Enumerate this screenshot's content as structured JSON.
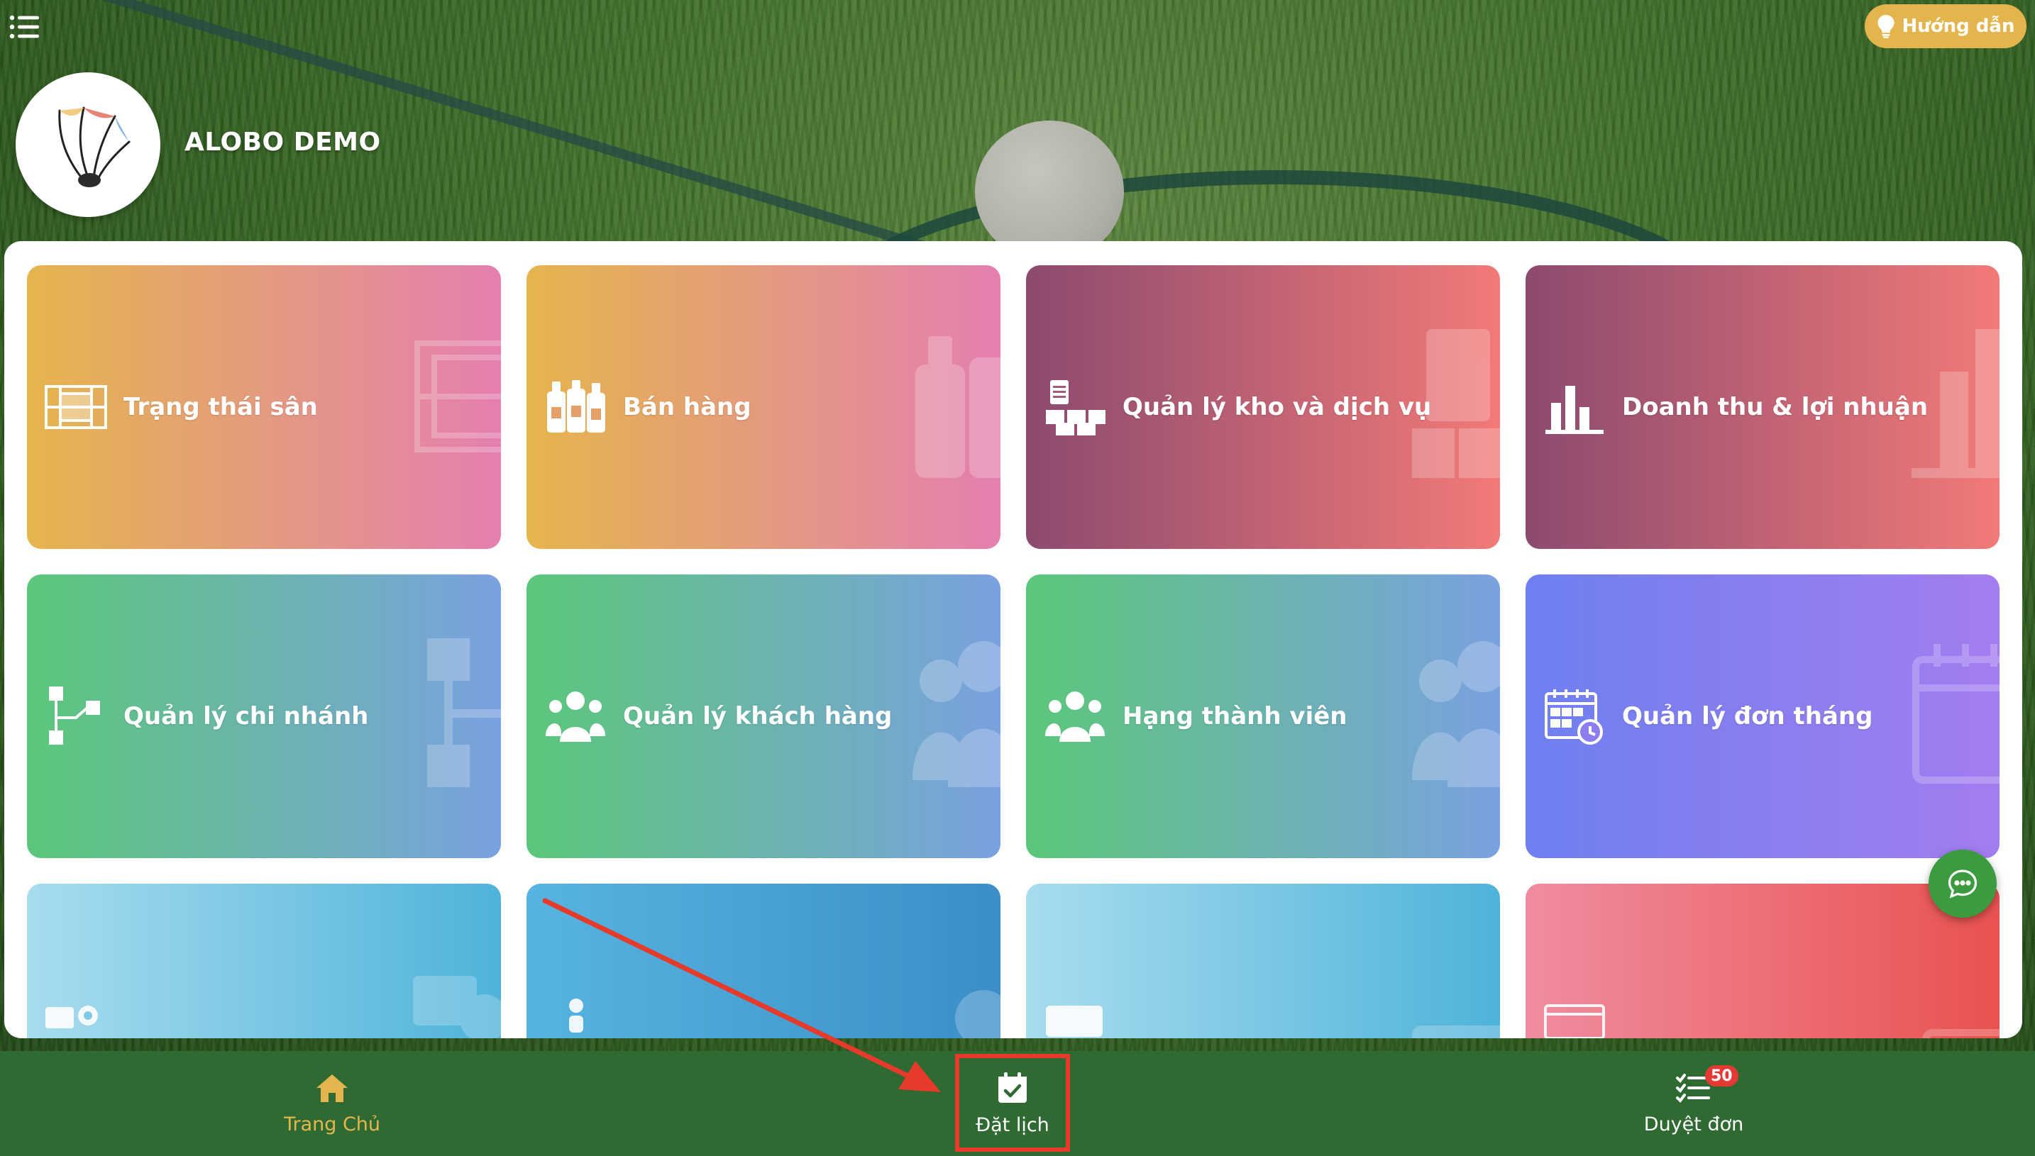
{
  "header": {
    "menu_icon": "hamburger-icon",
    "guide_button": {
      "label": "Hướng dẫn",
      "icon": "lightbulb-icon"
    },
    "brand": {
      "name": "ALOBO DEMO",
      "logo": "shuttlecock-logo"
    }
  },
  "cards": [
    {
      "label": "Trạng thái sân",
      "icon": "court-grid-icon",
      "gradient": [
        "#e5b54d",
        "#e47fb0"
      ]
    },
    {
      "label": "Bán hàng",
      "icon": "bottles-icon",
      "gradient": [
        "#e5b54d",
        "#e47fb0"
      ]
    },
    {
      "label": "Quản lý kho và dịch vụ",
      "icon": "inventory-icon",
      "gradient": [
        "#8c4a6f",
        "#f27a78"
      ]
    },
    {
      "label": "Doanh thu & lợi nhuận",
      "icon": "bar-chart-icon",
      "gradient": [
        "#8c4a6f",
        "#f27a78"
      ]
    },
    {
      "label": "Quản lý chi nhánh",
      "icon": "branch-tree-icon",
      "gradient": [
        "#5cc77a",
        "#7aa1e0"
      ]
    },
    {
      "label": "Quản lý khách hàng",
      "icon": "customers-icon",
      "gradient": [
        "#5cc77a",
        "#7aa1e0"
      ]
    },
    {
      "label": "Hạng thành viên",
      "icon": "members-icon",
      "gradient": [
        "#5cc77a",
        "#7aa1e0"
      ]
    },
    {
      "label": "Quản lý đơn tháng",
      "icon": "calendar-clock-icon",
      "gradient": [
        "#6e7ff0",
        "#a37df0"
      ]
    }
  ],
  "partial_cards": [
    {
      "icon": "settings-tools-icon",
      "gradient": [
        "#a8dcef",
        "#4fb3d9"
      ]
    },
    {
      "icon": "person-icon",
      "gradient": [
        "#57b4e0",
        "#3b8ec7"
      ]
    },
    {
      "icon": "id-card-icon",
      "gradient": [
        "#a8dcef",
        "#4fb3d9"
      ]
    },
    {
      "icon": "browser-window-icon",
      "gradient": [
        "#f08ca0",
        "#e9524f"
      ]
    }
  ],
  "chat_fab": {
    "icon": "chat-bubble-icon"
  },
  "bottom_nav": {
    "home": {
      "label": "Trang Chủ",
      "icon": "home-icon",
      "color": "#e5b54d"
    },
    "booking": {
      "label": "Đặt lịch",
      "icon": "calendar-check-icon"
    },
    "approve": {
      "label": "Duyệt đơn",
      "icon": "checklist-icon",
      "badge": "50"
    }
  },
  "annotation": {
    "color": "#e63a2b"
  }
}
